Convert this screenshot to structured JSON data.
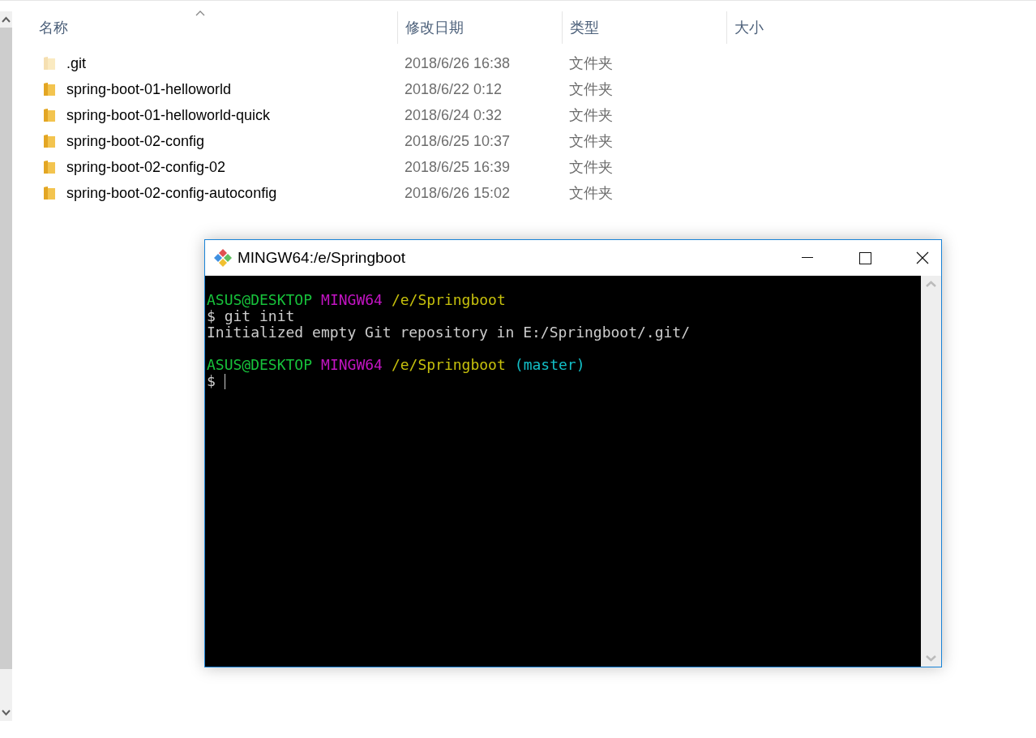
{
  "explorer": {
    "columns": [
      {
        "label": "名称",
        "sorted": true
      },
      {
        "label": "修改日期",
        "sorted": false
      },
      {
        "label": "类型",
        "sorted": false
      },
      {
        "label": "大小",
        "sorted": false
      }
    ],
    "rows": [
      {
        "name": ".git",
        "modified": "2018/6/26 16:38",
        "type": "文件夹",
        "hidden": true
      },
      {
        "name": "spring-boot-01-helloworld",
        "modified": "2018/6/22 0:12",
        "type": "文件夹",
        "hidden": false
      },
      {
        "name": "spring-boot-01-helloworld-quick",
        "modified": "2018/6/24 0:32",
        "type": "文件夹",
        "hidden": false
      },
      {
        "name": "spring-boot-02-config",
        "modified": "2018/6/25 10:37",
        "type": "文件夹",
        "hidden": false
      },
      {
        "name": "spring-boot-02-config-02",
        "modified": "2018/6/25 16:39",
        "type": "文件夹",
        "hidden": false
      },
      {
        "name": "spring-boot-02-config-autoconfig",
        "modified": "2018/6/26 15:02",
        "type": "文件夹",
        "hidden": false
      }
    ]
  },
  "terminal": {
    "title": "MINGW64:/e/Springboot",
    "lines": [
      {
        "kind": "text",
        "segments": [
          {
            "text": "ASUS@DESKTOP",
            "color": "#17c23b"
          },
          {
            "text": "MINGW64",
            "color": "#c414c4"
          },
          {
            "text": "/e/Springboot",
            "color": "#c6c00c"
          }
        ]
      },
      {
        "kind": "text",
        "segments": [
          {
            "text": "$ git init",
            "color": "#cccccc"
          }
        ]
      },
      {
        "kind": "text",
        "segments": [
          {
            "text": "Initialized empty Git repository in E:/Springboot/.git/",
            "color": "#cccccc"
          }
        ]
      },
      {
        "kind": "blank"
      },
      {
        "kind": "text",
        "segments": [
          {
            "text": "ASUS@DESKTOP",
            "color": "#17c23b"
          },
          {
            "text": "MINGW64",
            "color": "#c414c4"
          },
          {
            "text": "/e/Springboot",
            "color": "#c6c00c"
          },
          {
            "text": "(master)",
            "color": "#13c0c8"
          }
        ]
      },
      {
        "kind": "text",
        "segments": [
          {
            "text": "$",
            "color": "#cccccc"
          }
        ],
        "cursor": true
      }
    ]
  }
}
